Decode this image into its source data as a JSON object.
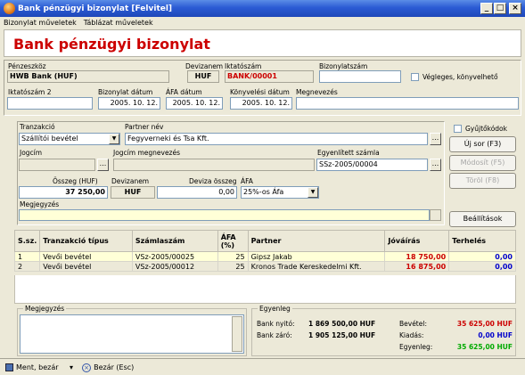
{
  "window": {
    "title": "Bank pénzügyi bizonylat [Felvitel]"
  },
  "menu": [
    "Bizonylat műveletek",
    "Táblázat műveletek"
  ],
  "header": {
    "title": "Bank pénzügyi bizonylat"
  },
  "form": {
    "penzeszkoz_label": "Pénzeszköz",
    "penzeszkoz_value": "HWB Bank (HUF)",
    "devizanem_label": "Devizanem",
    "devizanem_value": "HUF",
    "iktatoszam_label": "Iktatószám",
    "iktatoszam_value": "BANK/00001",
    "bizonylatszam_label": "Bizonylatszám",
    "bizonylatszam_value": "",
    "vegleges_label": "Végleges, könyvelhető",
    "iktatoszam2_label": "Iktatószám 2",
    "iktatoszam2_value": "",
    "bizonylat_datum_label": "Bizonylat dátum",
    "bizonylat_datum_value": "2005. 10. 12.",
    "afa_datum_label": "ÁFA dátum",
    "afa_datum_value": "2005. 10. 12.",
    "konyvelesi_datum_label": "Könyvelési dátum",
    "konyvelesi_datum_value": "2005. 10. 12.",
    "megnevezes_label": "Megnevezés",
    "megnevezes_value": ""
  },
  "tranz": {
    "tranzakcio_label": "Tranzakció",
    "tranzakcio_value": "Szállítói bevétel",
    "partner_nev_label": "Partner név",
    "partner_nev_value": "Fegyverneki és Tsa Kft.",
    "jogcim_label": "Jogcím",
    "jogcim_value": "",
    "jogcim_megnevezes_label": "Jogcím megnevezés",
    "jogcim_megnevezes_value": "",
    "egyenlitett_label": "Egyenlített számla",
    "egyenlitett_value": "SSz-2005/00004",
    "osszeg_label": "Összeg (HUF)",
    "osszeg_value": "37 250,00",
    "devizanem_label": "Devizanem",
    "devizanem_value": "HUF",
    "deviza_osszeg_label": "Deviza összeg",
    "deviza_osszeg_value": "0,00",
    "afa_label": "ÁFA",
    "afa_value": "25%-os Áfa",
    "megjegyzes_label": "Megjegyzés",
    "megjegyzes_value": ""
  },
  "side": {
    "gyujtokodok_label": "Gyűjtőkódok",
    "uj_sor": "Új sor (F3)",
    "modosit": "Módosít (F5)",
    "torol": "Töröl (F8)",
    "beallitasok": "Beállítások"
  },
  "table": {
    "headers": [
      "S.sz.",
      "Tranzakció típus",
      "Számlaszám",
      "ÁFA (%)",
      "Partner",
      "Jóváírás",
      "Terhelés"
    ],
    "rows": [
      [
        "1",
        "Vevői bevétel",
        "VSz-2005/00025",
        "25",
        "Gipsz Jakab",
        "18 750,00",
        "0,00"
      ],
      [
        "2",
        "Vevői bevétel",
        "VSz-2005/00012",
        "25",
        "Kronos Trade Kereskedelmi Kft.",
        "16 875,00",
        "0,00"
      ]
    ]
  },
  "bottom": {
    "megjegyzes_label": "Megjegyzés",
    "egyenleg_label": "Egyenleg",
    "bank_nyito_label": "Bank nyitó:",
    "bank_nyito_value": "1 869 500,00 HUF",
    "bank_zaro_label": "Bank záró:",
    "bank_zaro_value": "1 905 125,00 HUF",
    "bevetel_label": "Bevétel:",
    "bevetel_value": "35 625,00 HUF",
    "kiadas_label": "Kiadás:",
    "kiadas_value": "0,00 HUF",
    "egyenleg_row_label": "Egyenleg:",
    "egyenleg_value": "35 625,00 HUF"
  },
  "status": {
    "ment_bezar": "Ment, bezár",
    "bezar": "Bezár (Esc)"
  },
  "colors": {
    "accent_red": "#cc0000",
    "title_blue": "#2b5bd4",
    "note_yellow": "#ffffd7",
    "blue_value": "#0000cc",
    "green_value": "#00aa00"
  }
}
